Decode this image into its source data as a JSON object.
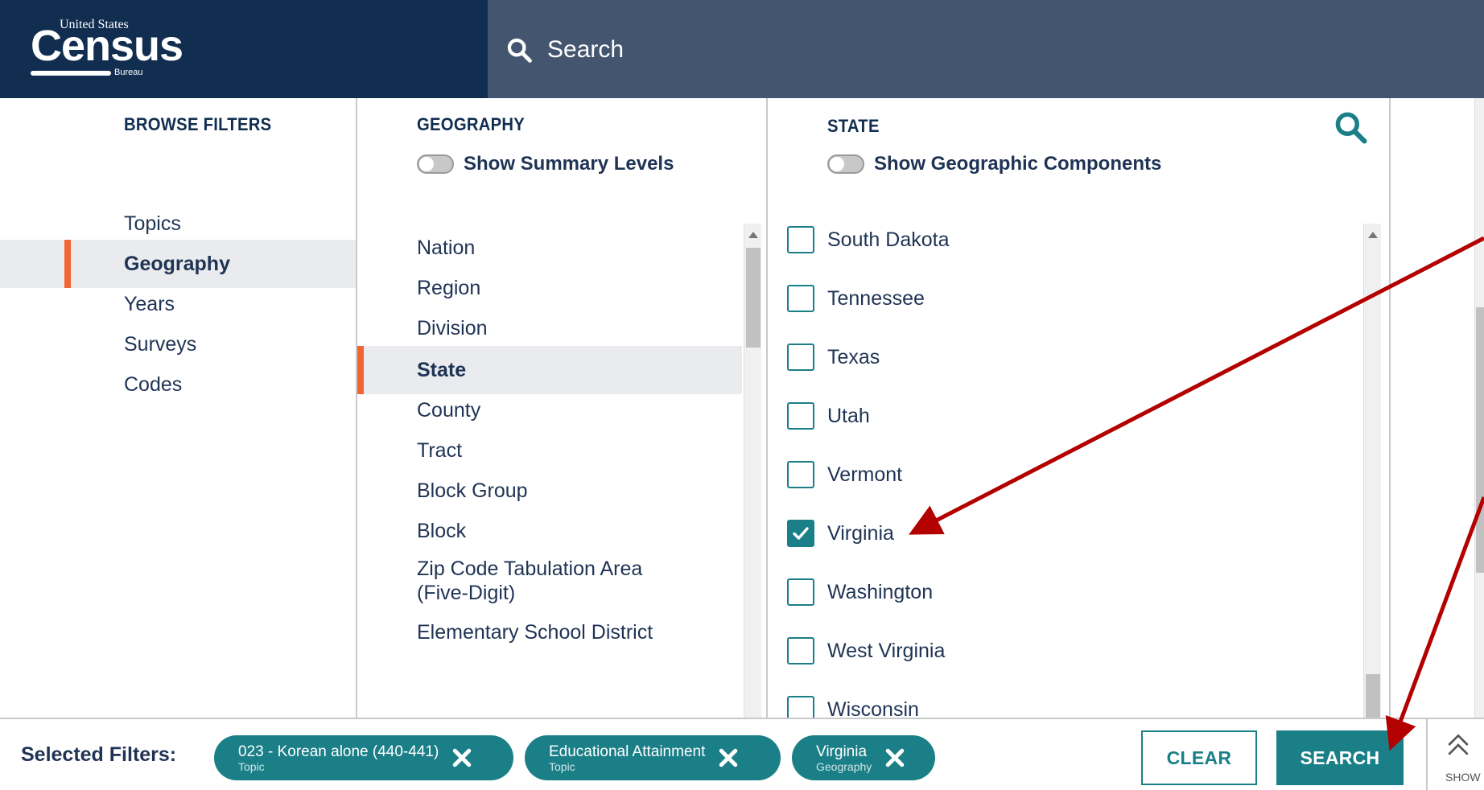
{
  "logo": {
    "top_text": "United States",
    "main_text": "Census",
    "sub_text": "Bureau"
  },
  "header": {
    "search_label": "Search"
  },
  "browse": {
    "title": "BROWSE FILTERS",
    "items": [
      {
        "label": "Topics",
        "active": false
      },
      {
        "label": "Geography",
        "active": true
      },
      {
        "label": "Years",
        "active": false
      },
      {
        "label": "Surveys",
        "active": false
      },
      {
        "label": "Codes",
        "active": false
      }
    ]
  },
  "geography": {
    "title": "GEOGRAPHY",
    "toggle_label": "Show Summary Levels",
    "items": [
      {
        "label": "Nation"
      },
      {
        "label": "Region"
      },
      {
        "label": "Division"
      },
      {
        "label": "State",
        "active": true
      },
      {
        "label": "County"
      },
      {
        "label": "Tract"
      },
      {
        "label": "Block Group"
      },
      {
        "label": "Block"
      },
      {
        "label": "Zip Code Tabulation Area (Five-Digit)"
      },
      {
        "label": "Elementary School District"
      }
    ]
  },
  "state": {
    "title": "STATE",
    "toggle_label": "Show Geographic Components",
    "items": [
      {
        "label": "South Dakota",
        "checked": false
      },
      {
        "label": "Tennessee",
        "checked": false
      },
      {
        "label": "Texas",
        "checked": false
      },
      {
        "label": "Utah",
        "checked": false
      },
      {
        "label": "Vermont",
        "checked": false
      },
      {
        "label": "Virginia",
        "checked": true
      },
      {
        "label": "Washington",
        "checked": false
      },
      {
        "label": "West Virginia",
        "checked": false
      },
      {
        "label": "Wisconsin",
        "checked": false
      }
    ]
  },
  "footer": {
    "label": "Selected Filters:",
    "chips": [
      {
        "name": "023 - Korean alone (440-441)",
        "category": "Topic"
      },
      {
        "name": "Educational Attainment",
        "category": "Topic"
      },
      {
        "name": "Virginia",
        "category": "Geography"
      }
    ],
    "clear_label": "CLEAR",
    "search_label": "SEARCH",
    "show_label": "SHOW"
  },
  "colors": {
    "header_bg": "#44556f",
    "logo_bg": "#112e51",
    "accent_teal": "#1b7f88",
    "active_marker": "#f26531",
    "annotation_arrow": "#b30000"
  },
  "icons": {
    "search": "search-icon",
    "chip_remove": "close-icon",
    "checkbox_checked": "checkmark-icon",
    "show_panel": "double-chevron-up-icon"
  }
}
